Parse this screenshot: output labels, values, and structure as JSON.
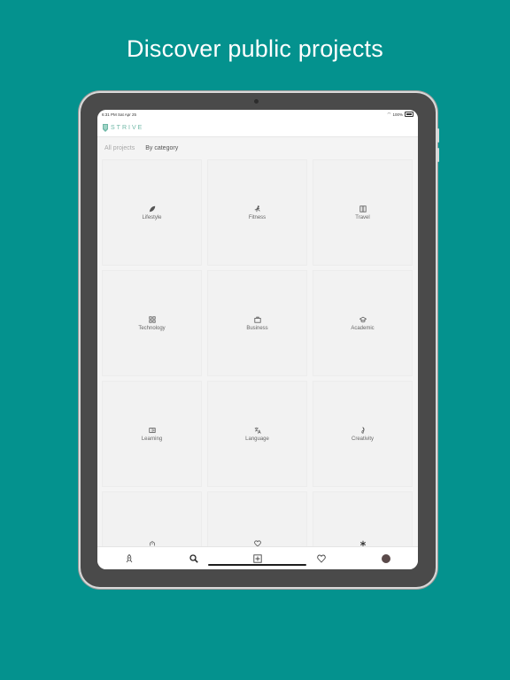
{
  "headline": "Discover public projects",
  "status": {
    "time": "6:31 PM",
    "date": "Sat Apr 25",
    "battery": "100%"
  },
  "app": {
    "name": "STRIVE",
    "accent": "#6fb7a6"
  },
  "tabs": [
    {
      "label": "All projects",
      "active": false
    },
    {
      "label": "By category",
      "active": true
    }
  ],
  "categories": [
    {
      "label": "Lifestyle",
      "icon": "leaf-icon"
    },
    {
      "label": "Fitness",
      "icon": "running-icon"
    },
    {
      "label": "Travel",
      "icon": "map-icon"
    },
    {
      "label": "Technology",
      "icon": "grid-icon"
    },
    {
      "label": "Business",
      "icon": "briefcase-icon"
    },
    {
      "label": "Academic",
      "icon": "graduation-cap-icon"
    },
    {
      "label": "Learning",
      "icon": "book-icon"
    },
    {
      "label": "Language",
      "icon": "translate-icon"
    },
    {
      "label": "Creativity",
      "icon": "music-icon"
    },
    {
      "label": "",
      "icon": "hand-heart-icon"
    },
    {
      "label": "",
      "icon": "heart-icon"
    },
    {
      "label": "",
      "icon": "asterisk-icon"
    }
  ],
  "bottom_nav": [
    {
      "name": "rocket-icon"
    },
    {
      "name": "search-icon"
    },
    {
      "name": "add-icon"
    },
    {
      "name": "heart-icon"
    },
    {
      "name": "avatar"
    }
  ],
  "colors": {
    "background": "#04928e",
    "device": "#4a4a4a"
  }
}
